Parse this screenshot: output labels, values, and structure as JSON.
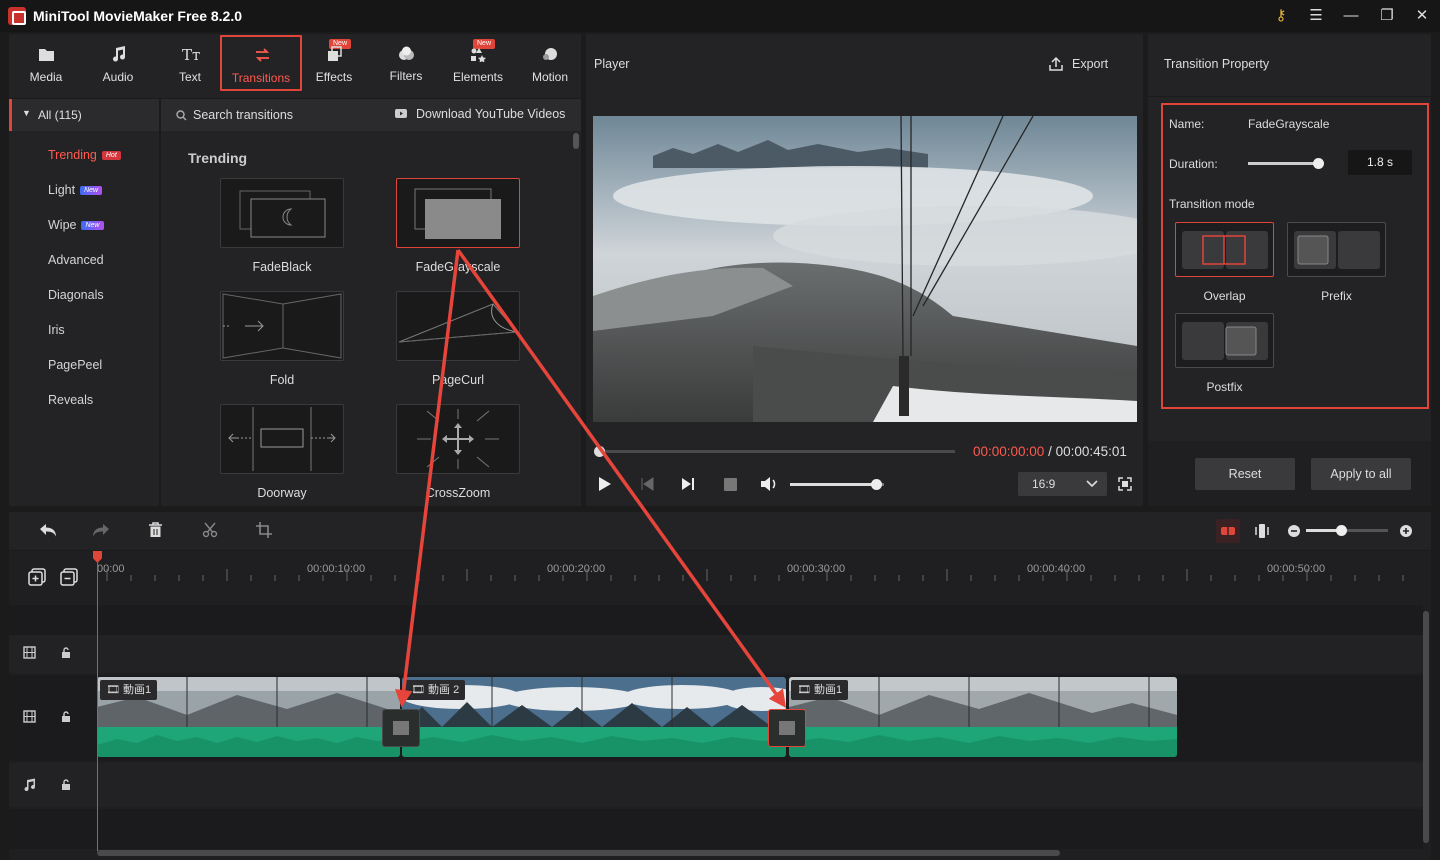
{
  "window": {
    "title": "MiniTool MovieMaker Free 8.2.0"
  },
  "tabs": [
    {
      "label": "Media",
      "badge": ""
    },
    {
      "label": "Audio",
      "badge": ""
    },
    {
      "label": "Text",
      "badge": ""
    },
    {
      "label": "Transitions",
      "badge": ""
    },
    {
      "label": "Effects",
      "badge": "New"
    },
    {
      "label": "Filters",
      "badge": ""
    },
    {
      "label": "Elements",
      "badge": "New"
    },
    {
      "label": "Motion",
      "badge": ""
    }
  ],
  "categories": {
    "all_label": "All (115)",
    "items": [
      {
        "label": "Trending",
        "badge": "Hot"
      },
      {
        "label": "Light",
        "badge": "New"
      },
      {
        "label": "Wipe",
        "badge": "New"
      },
      {
        "label": "Advanced",
        "badge": ""
      },
      {
        "label": "Diagonals",
        "badge": ""
      },
      {
        "label": "Iris",
        "badge": ""
      },
      {
        "label": "PagePeel",
        "badge": ""
      },
      {
        "label": "Reveals",
        "badge": ""
      }
    ]
  },
  "library": {
    "search_placeholder": "Search transitions",
    "download_label": "Download YouTube Videos",
    "section_title": "Trending",
    "items": [
      "FadeBlack",
      "FadeGrayscale",
      "Fold",
      "PageCurl",
      "Doorway",
      "CrossZoom"
    ]
  },
  "player": {
    "title": "Player",
    "export_label": "Export",
    "current_time": "00:00:00:00",
    "separator": " / ",
    "total_time": "00:00:45:01",
    "aspect_ratio": "16:9",
    "volume_level": 0.91
  },
  "properties": {
    "title": "Transition Property",
    "name_label": "Name:",
    "name_value": "FadeGrayscale",
    "duration_label": "Duration:",
    "duration_value": "1.8 s",
    "mode_title": "Transition mode",
    "modes": [
      "Overlap",
      "Prefix",
      "Postfix"
    ],
    "reset_label": "Reset",
    "apply_all_label": "Apply to all"
  },
  "timeline": {
    "ruler": [
      "00:00",
      "00:00:10:00",
      "00:00:20:00",
      "00:00:30:00",
      "00:00:40:00",
      "00:00:50:00"
    ],
    "clips": [
      "動画1",
      "動画 2",
      "動画1"
    ]
  },
  "colors": {
    "accent": "#e0453a",
    "waveform": "#1fa678"
  }
}
